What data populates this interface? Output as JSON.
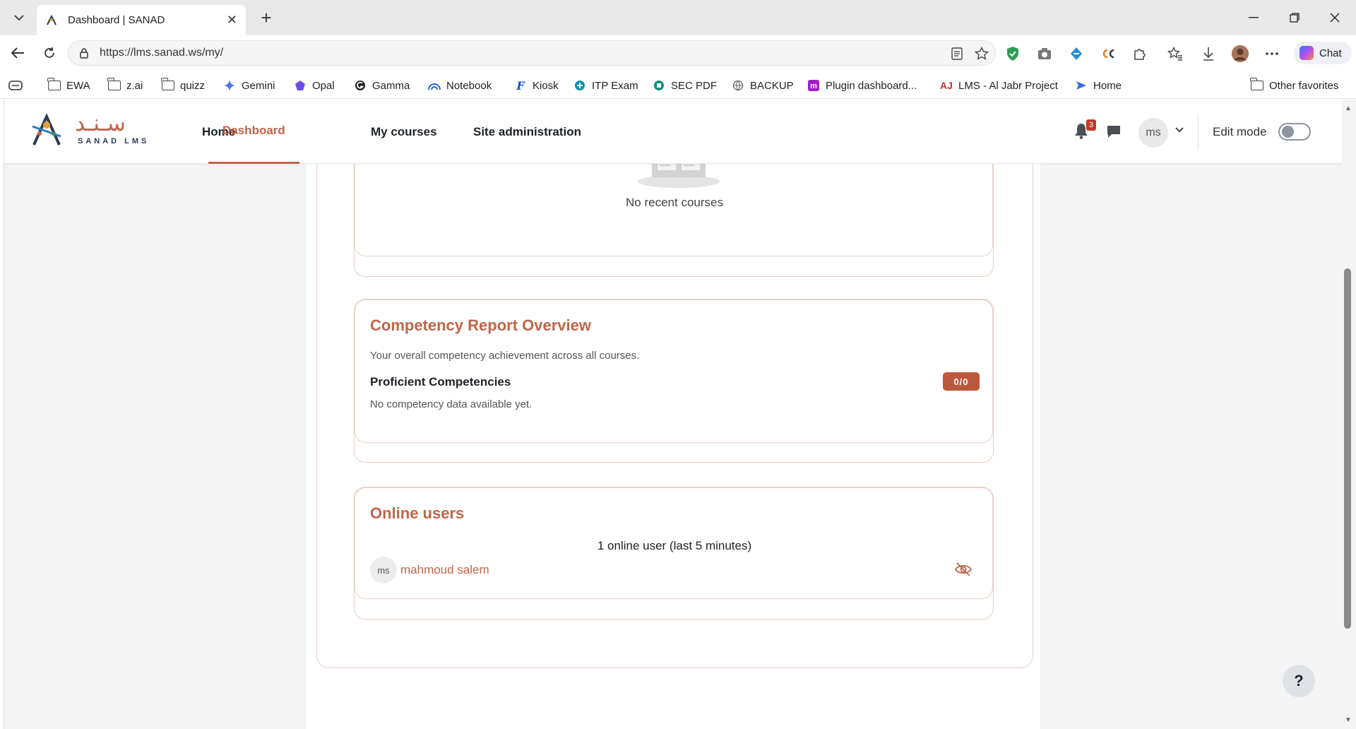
{
  "browser": {
    "tab_title": "Dashboard | SANAD",
    "url": "https://lms.sanad.ws/my/",
    "chat_label": "Chat",
    "bookmarks": [
      {
        "label": "EWA",
        "icon": "folder-icon"
      },
      {
        "label": "z.ai",
        "icon": "folder-icon"
      },
      {
        "label": "quizz",
        "icon": "folder-icon"
      },
      {
        "label": "Gemini",
        "icon": "gemini-icon"
      },
      {
        "label": "Opal",
        "icon": "opal-icon"
      },
      {
        "label": "Gamma",
        "icon": "gamma-icon"
      },
      {
        "label": "Notebook",
        "icon": "notebook-icon"
      },
      {
        "label": "Kiosk",
        "icon": "kiosk-icon"
      },
      {
        "label": "ITP Exam",
        "icon": "itp-icon"
      },
      {
        "label": "SEC PDF",
        "icon": "sec-icon"
      },
      {
        "label": "BACKUP",
        "icon": "globe-icon"
      },
      {
        "label": "Plugin dashboard...",
        "icon": "moodle-icon"
      },
      {
        "label": "LMS - Al Jabr Project",
        "icon": "aj-icon"
      },
      {
        "label": "Home",
        "icon": "home-arrow-icon"
      }
    ],
    "other_favorites": "Other favorites"
  },
  "site": {
    "logo_arabic": "سـنـد",
    "logo_english": "SANAD LMS",
    "nav": [
      {
        "label": "Home",
        "active": false
      },
      {
        "label": "Dashboard",
        "active": true
      },
      {
        "label": "My courses",
        "active": false
      },
      {
        "label": "Site administration",
        "active": false
      }
    ],
    "notification_count": "3",
    "user_initials": "ms",
    "edit_mode_label": "Edit mode",
    "edit_mode_on": false,
    "accent_color": "#c0654a"
  },
  "recent_courses": {
    "empty_text": "No recent courses"
  },
  "competency": {
    "title": "Competency Report Overview",
    "description": "Your overall competency achievement across all courses.",
    "label": "Proficient Competencies",
    "badge": "0/0",
    "empty_text": "No competency data available yet."
  },
  "online_users": {
    "title": "Online users",
    "count_text": "1 online user (last 5 minutes)",
    "users": [
      {
        "initials": "ms",
        "name": "mahmoud salem"
      }
    ]
  },
  "help_label": "?"
}
